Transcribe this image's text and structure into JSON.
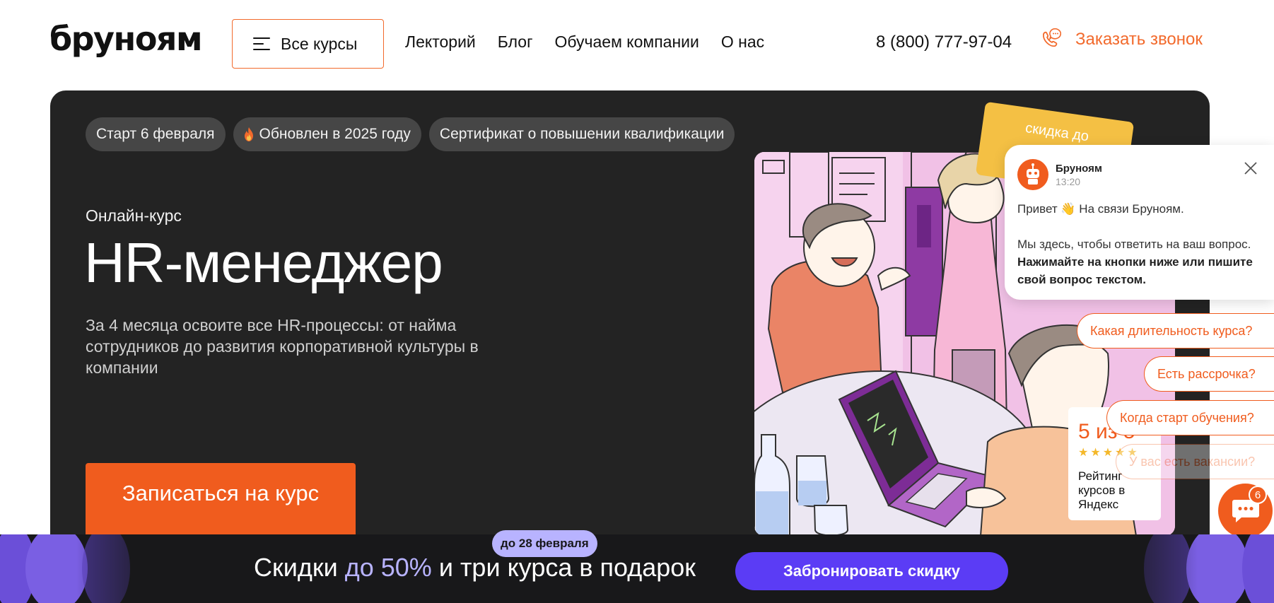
{
  "header": {
    "logo": "бруноям",
    "all_courses_label": "Все курсы",
    "nav": [
      "Лекторий",
      "Блог",
      "Обучаем компании",
      "О нас"
    ],
    "phone": "8 (800) 777-97-04",
    "callback_label": "Заказать звонок"
  },
  "hero": {
    "badges": [
      "Старт 6 февраля",
      "Обновлен в 2025 году",
      "Сертификат о повышении квалификации"
    ],
    "eyebrow": "Онлайн-курс",
    "title": "HR-менеджер",
    "description": "За 4 месяца освоите все HR-процессы: от найма сотрудников до развития корпоративной культуры в компании",
    "cta_label": "Записаться на курс",
    "coupon_text": "скидка до",
    "rating": {
      "score": "5 из 5",
      "stars": 5,
      "label": "Рейтинг курсов в Яндекс"
    }
  },
  "chat": {
    "bot_name": "Бруноям",
    "time": "13:20",
    "greeting": "Привет 👋 На связи Бруноям.",
    "text_regular": "Мы здесь, чтобы ответить на ваш вопрос. ",
    "text_bold": "Нажимайте на кнопки ниже или пишите свой вопрос текстом.",
    "quick_replies": [
      "Какая длительность курса?",
      "Есть рассрочка?",
      "Когда старт обучения?",
      "У вас есть вакансии?"
    ],
    "unread_count": "6"
  },
  "promo": {
    "tag": "до 28 февраля",
    "text_before": "Скидки ",
    "text_accent": "до 50%",
    "text_after": " и три курса в подарок",
    "button_label": "Забронировать скидку"
  },
  "colors": {
    "accent": "#f05c1e",
    "hero_bg": "#232323",
    "promo_bg": "#18181a",
    "promo_button": "#5b3cf5",
    "promo_accent": "#b8b3ff"
  }
}
